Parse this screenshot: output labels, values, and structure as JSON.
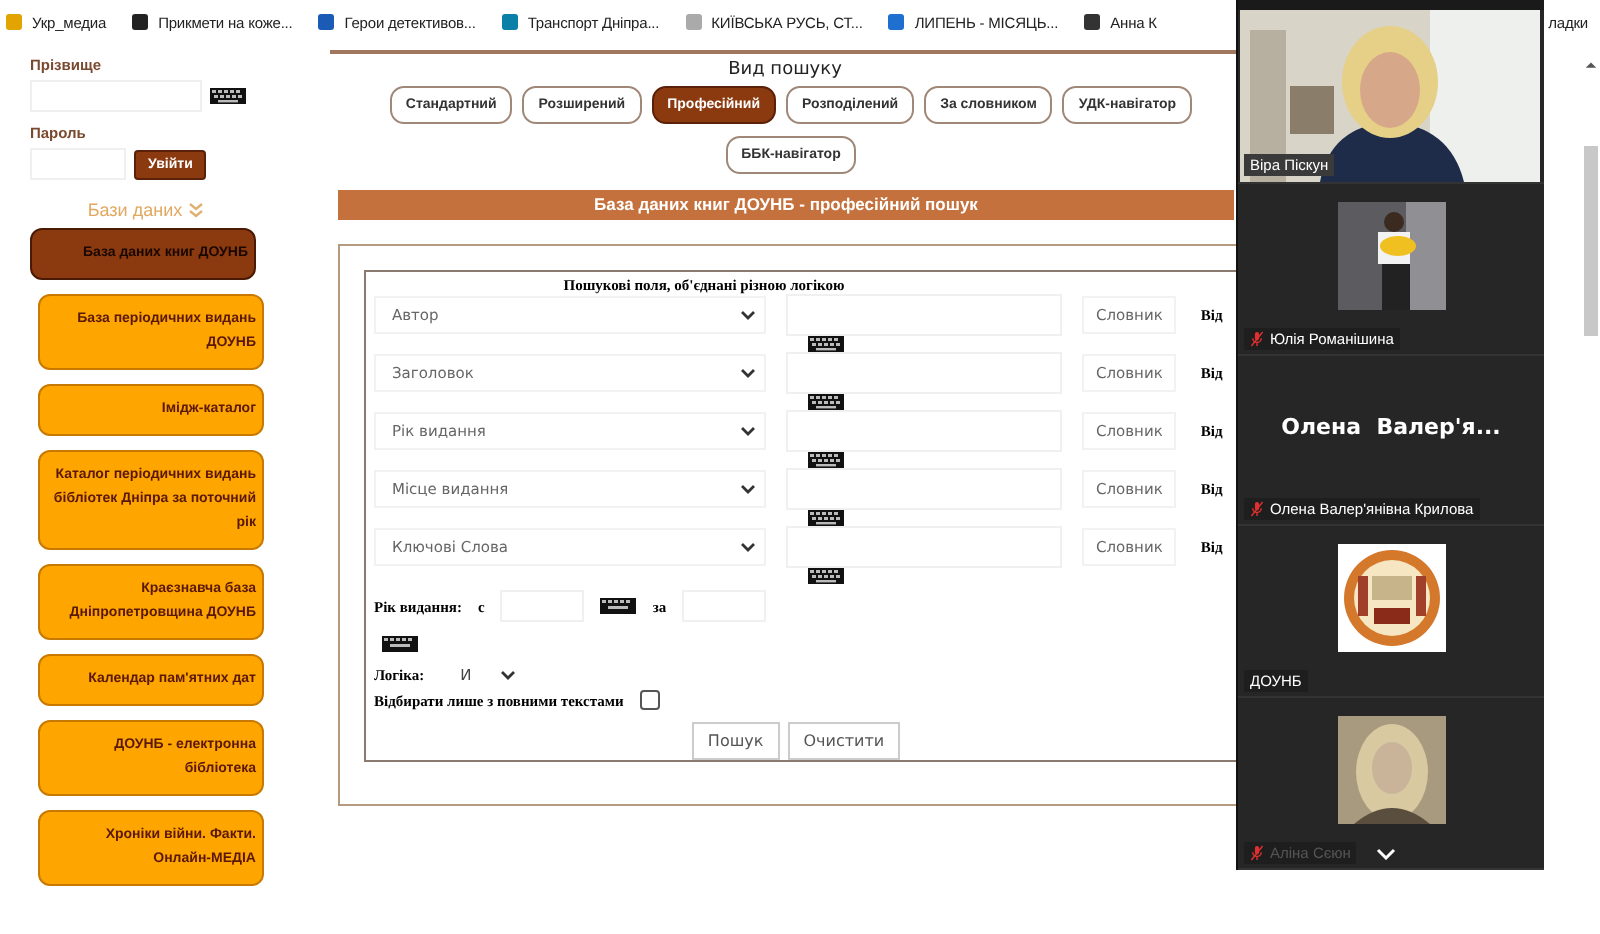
{
  "bookmarks": [
    {
      "label": "Укр_медиа"
    },
    {
      "label": "Прикмети на коже..."
    },
    {
      "label": "Герои детективов..."
    },
    {
      "label": "Транспорт Дніпра..."
    },
    {
      "label": "КИЇВСЬКА РУСЬ, СТ..."
    },
    {
      "label": "ЛИПЕНЬ - МІСЯЦЬ..."
    },
    {
      "label": "Анна К"
    }
  ],
  "bookmarks_right": "ладки",
  "sidebar": {
    "surname_label": "Прізвище",
    "password_label": "Пароль",
    "login_button": "Увійти",
    "databases_heading": "Бази даних",
    "databases": [
      {
        "label": "База даних книг ДОУНБ",
        "selected": true
      },
      {
        "label": "База періодичних видань ДОУНБ",
        "selected": false
      },
      {
        "label": "Імідж-каталог",
        "selected": false
      },
      {
        "label": "Каталог періодичних видань бібліотек Дніпра за поточний рік",
        "selected": false
      },
      {
        "label": "Краєзнавча база Дніпропетровщина ДОУНБ",
        "selected": false
      },
      {
        "label": "Календар пам'ятних дат",
        "selected": false
      },
      {
        "label": "ДОУНБ - електронна бібліотека",
        "selected": false
      },
      {
        "label": "Хроніки війни. Факти. Онлайн-МЕДІА",
        "selected": false
      }
    ]
  },
  "search": {
    "heading": "Вид пошуку",
    "modes": [
      {
        "label": "Стандартний",
        "selected": false
      },
      {
        "label": "Розширений",
        "selected": false
      },
      {
        "label": "Професійний",
        "selected": true
      },
      {
        "label": "Розподілений",
        "selected": false
      },
      {
        "label": "За словником",
        "selected": false
      },
      {
        "label": "УДК-навігатор",
        "selected": false
      },
      {
        "label": "ББК-навігатор",
        "selected": false
      }
    ],
    "title": "База даних книг ДОУНБ - професійний пошук",
    "legend": "Пошукові поля, об'єднані різною логікою",
    "rows": [
      {
        "field": "Автор",
        "dict_button": "Словник",
        "cut_label": "Від"
      },
      {
        "field": "Заголовок",
        "dict_button": "Словник",
        "cut_label": "Від"
      },
      {
        "field": "Рік видання",
        "dict_button": "Словник",
        "cut_label": "Від"
      },
      {
        "field": "Місце видання",
        "dict_button": "Словник",
        "cut_label": "Від"
      },
      {
        "field": "Ключові Слова",
        "dict_button": "Словник",
        "cut_label": "Від"
      }
    ],
    "year_label": "Рік видання:",
    "year_from": "с",
    "year_to": "за",
    "logic_label": "Логіка:",
    "logic_value": "И",
    "fulltext_label": "Відбирати лише з повними текстами",
    "fulltext_checked": false,
    "buttons": [
      "Пошук",
      "Очистити"
    ]
  },
  "video_panel": {
    "participants": [
      {
        "kind": "video",
        "name": "Віра Піскун",
        "muted": false
      },
      {
        "kind": "thumbnail",
        "name": "Юлія Романішина",
        "muted": true
      },
      {
        "kind": "name_card",
        "display": "Олена  Валер'я...",
        "name": "Олена Валер'янівна Крилова",
        "muted": true
      },
      {
        "kind": "logo",
        "name": "ДОУНБ",
        "muted": false
      },
      {
        "kind": "thumbnail_faded",
        "name": "Аліна Сєюн",
        "muted": true
      }
    ]
  }
}
